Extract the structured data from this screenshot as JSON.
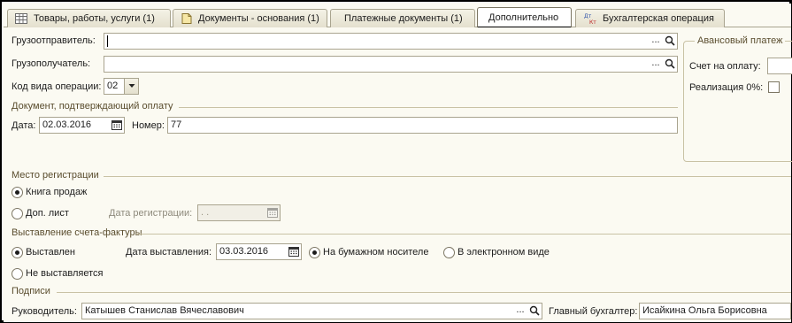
{
  "tabs": [
    {
      "label": "Товары, работы, услуги (1)",
      "icon": "table-icon"
    },
    {
      "label": "Документы - основания (1)",
      "icon": "document-icon"
    },
    {
      "label": "Платежные документы (1)"
    },
    {
      "label": "Дополнительно",
      "active": true
    },
    {
      "label": "Бухгалтерская операция",
      "icon": "dt-kt-icon"
    }
  ],
  "shipper": {
    "label": "Грузоотправитель:",
    "value": ""
  },
  "consignee": {
    "label": "Грузополучатель:",
    "value": ""
  },
  "operation_code": {
    "label": "Код вида операции:",
    "value": "02"
  },
  "payment_doc": {
    "title": "Документ, подтверждающий оплату",
    "date_label": "Дата:",
    "date_value": "02.03.2016",
    "number_label": "Номер:",
    "number_value": "77"
  },
  "advance": {
    "title": "Авансовый платеж",
    "invoice_label": "Счет на оплату:",
    "realization_label": "Реализация 0%:"
  },
  "registration": {
    "title": "Место регистрации",
    "sales_book": "Книга продаж",
    "additional_sheet": "Доп. лист",
    "reg_date_label": "Дата регистрации:",
    "reg_date_placeholder": " .  .  "
  },
  "invoice_issue": {
    "title": "Выставление счета-фактуры",
    "issued": "Выставлен",
    "not_issued": "Не выставляется",
    "issue_date_label": "Дата выставления:",
    "issue_date_value": "03.03.2016",
    "paper": "На бумажном носителе",
    "electronic": "В электронном виде"
  },
  "signatures": {
    "title": "Подписи",
    "head_label": "Руководитель:",
    "head_value": "Катышев Станислав Вячеславович",
    "accountant_label": "Главный бухгалтер:",
    "accountant_value": "Исайкина Ольга Борисовна"
  },
  "colors": {
    "background": "#fbfaf2",
    "border": "#a9a48f",
    "section": "#5a4d2e"
  }
}
